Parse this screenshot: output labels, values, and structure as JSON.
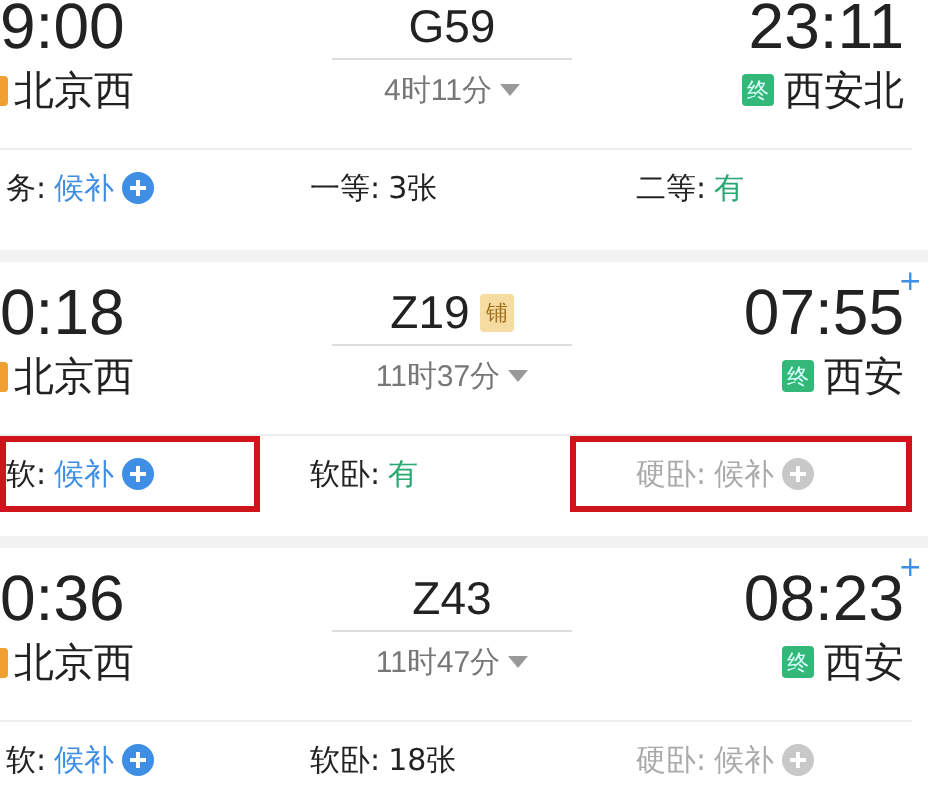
{
  "trains": [
    {
      "depart_time": "9:00",
      "depart_station": "北京西",
      "number": "G59",
      "duration": "4时11分",
      "arrive_time": "23:11",
      "arrive_badge": "终",
      "arrive_station": "西安北",
      "seats": [
        {
          "label": "务:",
          "status": "候补",
          "kind": "waitlist",
          "disabled": false,
          "highlighted": false
        },
        {
          "label": "一等:",
          "status": "3张",
          "kind": "count",
          "disabled": false,
          "highlighted": false
        },
        {
          "label": "二等:",
          "status": "有",
          "kind": "available",
          "disabled": false,
          "highlighted": false
        }
      ]
    },
    {
      "depart_time": "0:18",
      "depart_station": "北京西",
      "number": "Z19",
      "badge": "铺",
      "duration": "11时37分",
      "arrive_time": "07:55",
      "arrive_plus": "+",
      "arrive_badge": "终",
      "arrive_station": "西安",
      "seats": [
        {
          "label": "软:",
          "status": "候补",
          "kind": "waitlist",
          "disabled": false,
          "highlighted": true
        },
        {
          "label": "软卧:",
          "status": "有",
          "kind": "available",
          "disabled": false,
          "highlighted": false
        },
        {
          "label": "硬卧:",
          "status": "候补",
          "kind": "waitlist",
          "disabled": true,
          "highlighted": true
        }
      ]
    },
    {
      "depart_time": "0:36",
      "depart_station": "北京西",
      "number": "Z43",
      "duration": "11时47分",
      "arrive_time": "08:23",
      "arrive_plus": "+",
      "arrive_badge": "终",
      "arrive_station": "西安",
      "seats": [
        {
          "label": "软:",
          "status": "候补",
          "kind": "waitlist",
          "disabled": false,
          "highlighted": false
        },
        {
          "label": "软卧:",
          "status": "18张",
          "kind": "count",
          "disabled": false,
          "highlighted": false
        },
        {
          "label": "硬卧:",
          "status": "候补",
          "kind": "waitlist",
          "disabled": true,
          "highlighted": false
        }
      ]
    }
  ]
}
